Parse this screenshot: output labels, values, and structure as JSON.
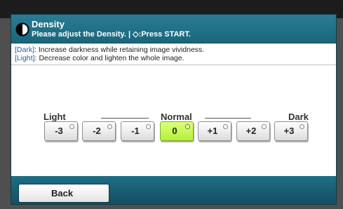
{
  "header": {
    "title": "Density",
    "subtitle": "Please adjust the Density. | ◇:Press START."
  },
  "info": {
    "line1_tag": "[Dark]",
    "line1_text": ": Increase darkness while retaining image vividness.",
    "line2_tag": "[Light]",
    "line2_text": ": Decrease color and lighten the whole image."
  },
  "scale": {
    "light_label": "Light",
    "normal_label": "Normal",
    "dark_label": "Dark"
  },
  "levels": [
    "-3",
    "-2",
    "-1",
    "0",
    "+1",
    "+2",
    "+3"
  ],
  "selected_level": "0",
  "footer": {
    "back_label": "Back"
  },
  "colors": {
    "header": "#1f7189",
    "selected_button": "#c6f74f",
    "info_tag": "#1f5fa8"
  },
  "icons": {
    "header_icon": "contrast-icon"
  }
}
